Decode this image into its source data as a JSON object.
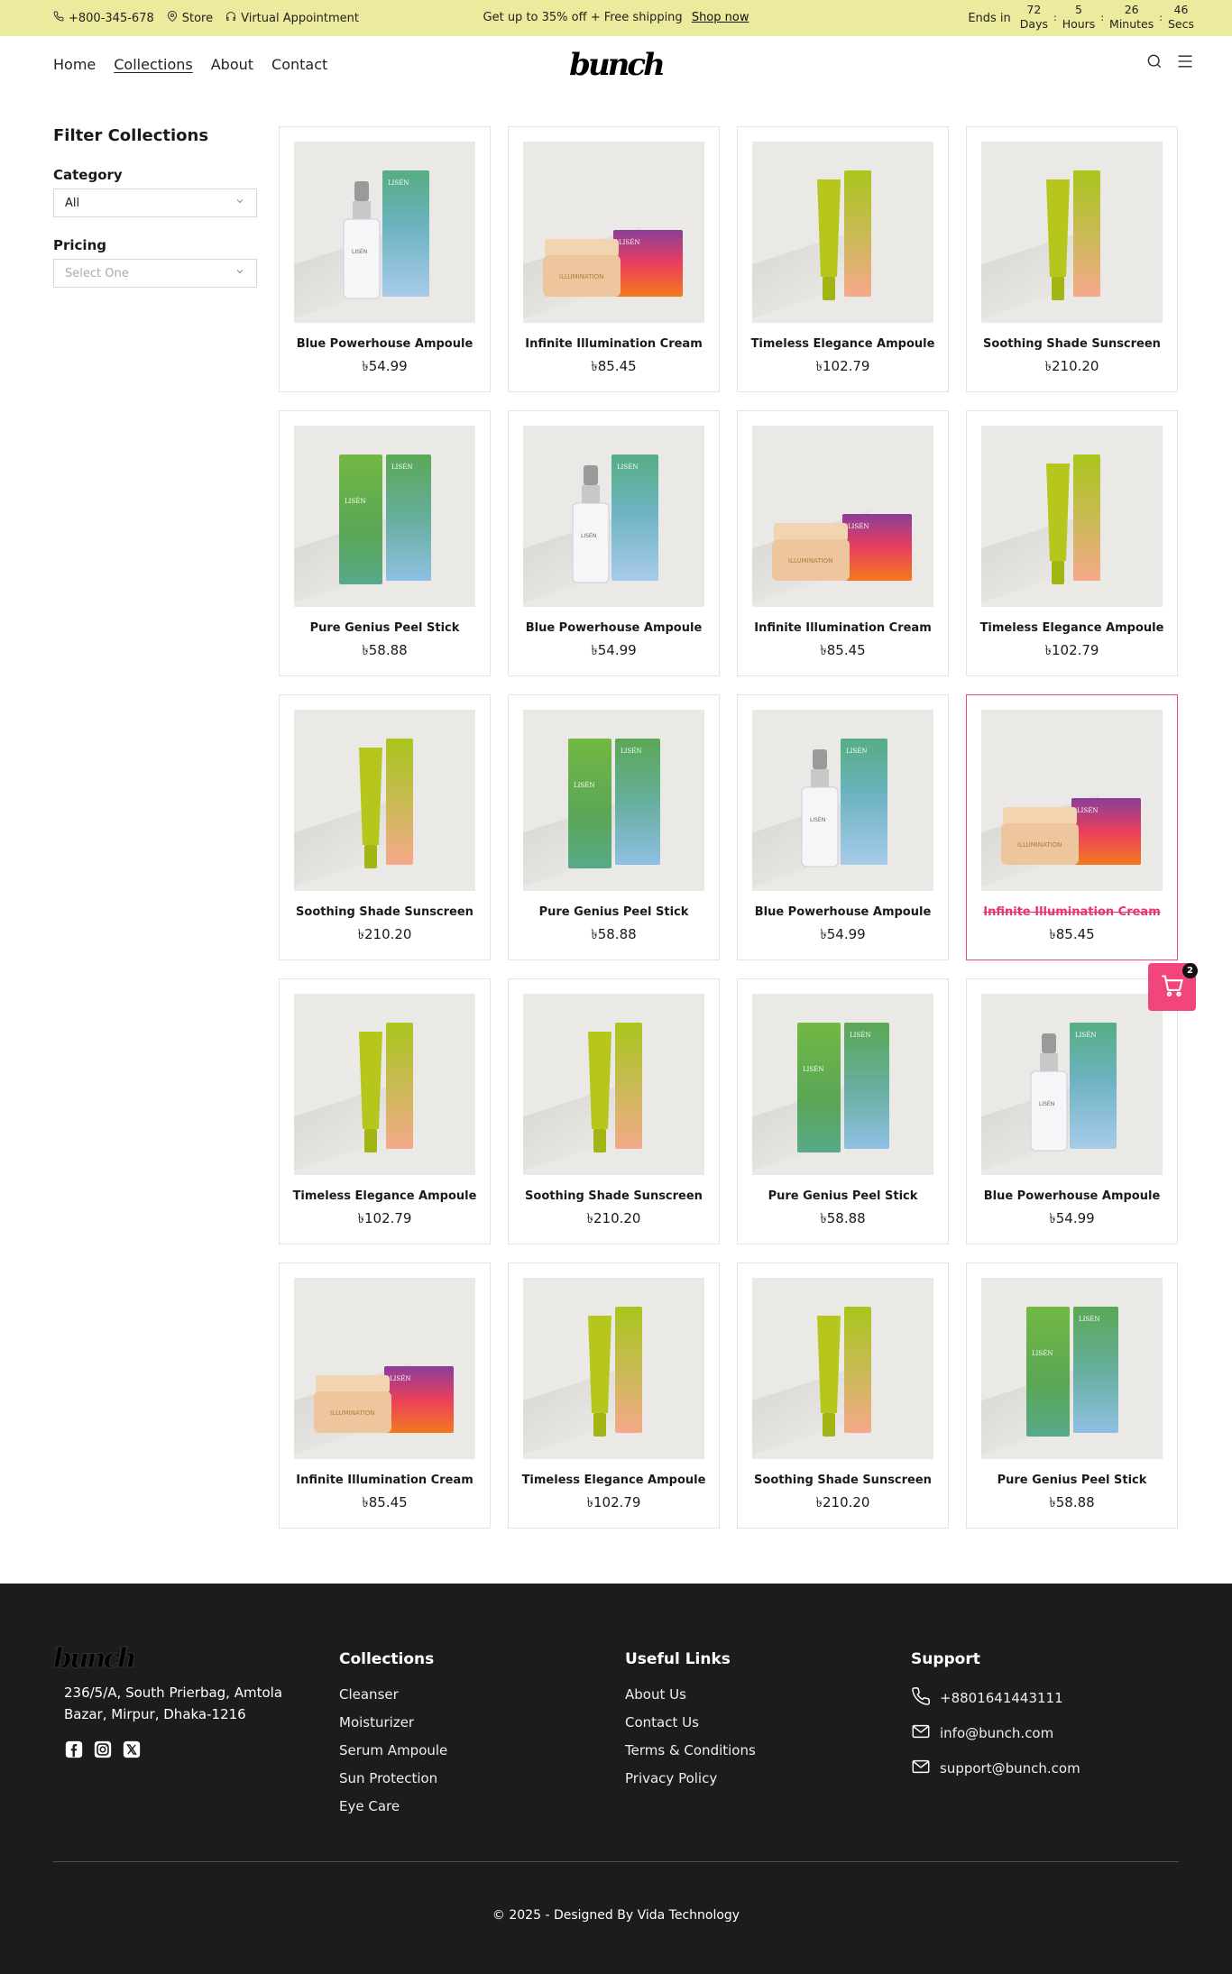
{
  "topbar": {
    "phone": "+800-345-678",
    "store": "Store",
    "appointment": "Virtual Appointment",
    "promo": "Get up to 35% off + Free shipping",
    "promo_link": "Shop now",
    "ends_in": "Ends in",
    "countdown": [
      {
        "value": "72",
        "unit": "Days"
      },
      {
        "value": "5",
        "unit": "Hours"
      },
      {
        "value": "26",
        "unit": "Minutes"
      },
      {
        "value": "46",
        "unit": "Secs"
      }
    ]
  },
  "nav": {
    "links": [
      "Home",
      "Collections",
      "About",
      "Contact"
    ],
    "logo": "bunch"
  },
  "sidebar": {
    "title": "Filter Collections",
    "category_label": "Category",
    "category_value": "All",
    "pricing_label": "Pricing",
    "pricing_placeholder": "Select One"
  },
  "products": [
    {
      "name": "Blue Powerhouse Ampoule",
      "price": "৳54.99",
      "kind": "ampoule"
    },
    {
      "name": "Infinite Illumination Cream",
      "price": "৳85.45",
      "kind": "cream"
    },
    {
      "name": "Timeless Elegance Ampoule",
      "price": "৳102.79",
      "kind": "tube"
    },
    {
      "name": "Soothing Shade Sunscreen",
      "price": "৳210.20",
      "kind": "tube"
    },
    {
      "name": "Pure Genius Peel Stick",
      "price": "৳58.88",
      "kind": "stick"
    },
    {
      "name": "Blue Powerhouse Ampoule",
      "price": "৳54.99",
      "kind": "ampoule"
    },
    {
      "name": "Infinite Illumination Cream",
      "price": "৳85.45",
      "kind": "cream"
    },
    {
      "name": "Timeless Elegance Ampoule",
      "price": "৳102.79",
      "kind": "tube"
    },
    {
      "name": "Soothing Shade Sunscreen",
      "price": "৳210.20",
      "kind": "tube"
    },
    {
      "name": "Pure Genius Peel Stick",
      "price": "৳58.88",
      "kind": "stick"
    },
    {
      "name": "Blue Powerhouse Ampoule",
      "price": "৳54.99",
      "kind": "ampoule"
    },
    {
      "name": "Infinite Illumination Cream",
      "price": "৳85.45",
      "kind": "cream",
      "hovered": true
    },
    {
      "name": "Timeless Elegance Ampoule",
      "price": "৳102.79",
      "kind": "tube"
    },
    {
      "name": "Soothing Shade Sunscreen",
      "price": "৳210.20",
      "kind": "tube"
    },
    {
      "name": "Pure Genius Peel Stick",
      "price": "৳58.88",
      "kind": "stick"
    },
    {
      "name": "Blue Powerhouse Ampoule",
      "price": "৳54.99",
      "kind": "ampoule"
    },
    {
      "name": "Infinite Illumination Cream",
      "price": "৳85.45",
      "kind": "cream"
    },
    {
      "name": "Timeless Elegance Ampoule",
      "price": "৳102.79",
      "kind": "tube"
    },
    {
      "name": "Soothing Shade Sunscreen",
      "price": "৳210.20",
      "kind": "tube"
    },
    {
      "name": "Pure Genius Peel Stick",
      "price": "৳58.88",
      "kind": "stick"
    }
  ],
  "cart": {
    "count": "2"
  },
  "footer": {
    "logo": "bunch",
    "address": "236/5/A, South Prierbag, Amtola Bazar, Mirpur, Dhaka-1216",
    "collections_title": "Collections",
    "collections": [
      "Cleanser",
      "Moisturizer",
      "Serum Ampoule",
      "Sun Protection",
      "Eye Care"
    ],
    "links_title": "Useful Links",
    "links": [
      "About Us",
      "Contact Us",
      "Terms & Conditions",
      "Privacy Policy"
    ],
    "support_title": "Support",
    "phone": "+8801641443111",
    "email1": "info@bunch.com",
    "email2": "support@bunch.com",
    "copyright": "© 2025 - Designed By  Vida Technology"
  },
  "colors": {
    "topbar_bg": "#ecea9c",
    "accent": "#f2457c",
    "footer_bg": "#1c1c1c"
  }
}
